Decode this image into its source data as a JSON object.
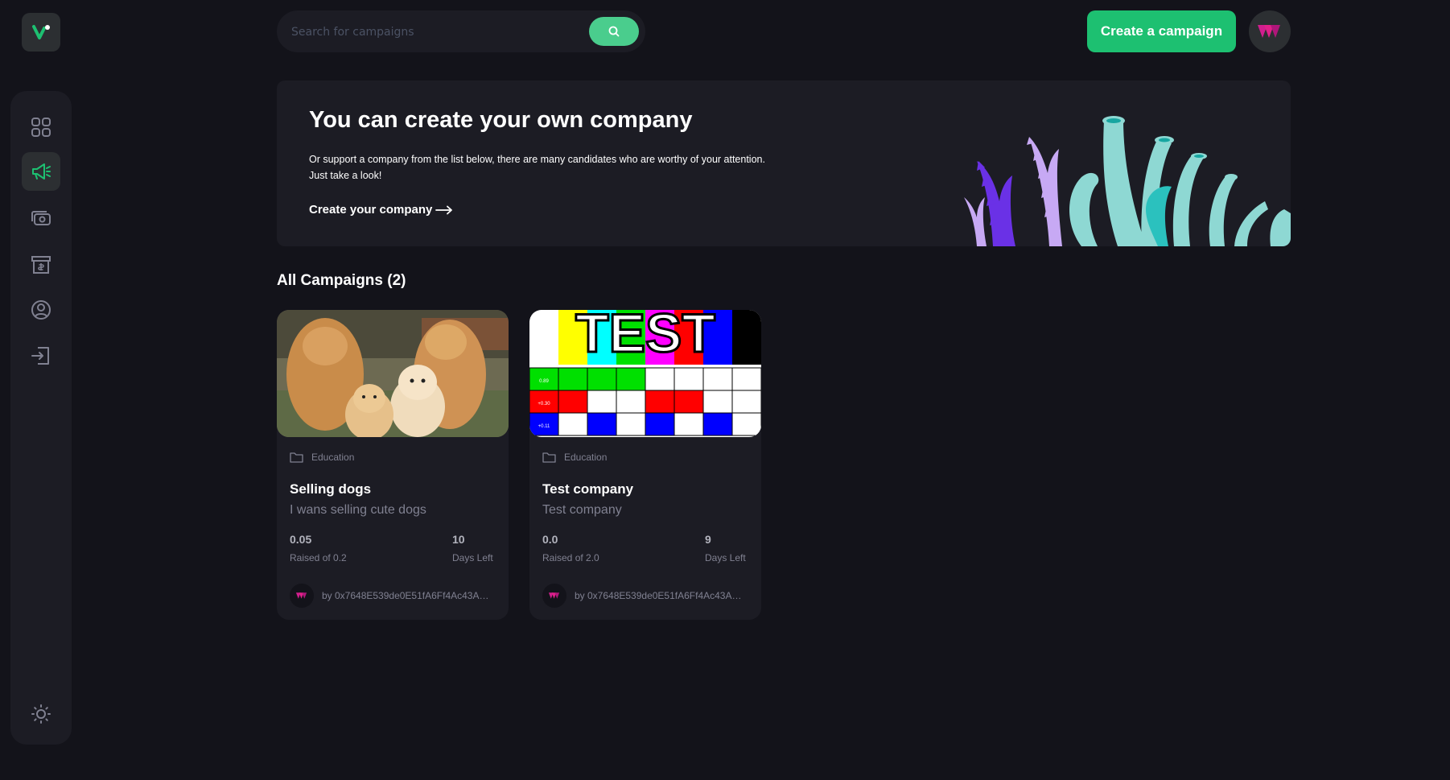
{
  "search": {
    "placeholder": "Search for campaigns"
  },
  "header": {
    "create_label": "Create a campaign"
  },
  "sidebar": {
    "items": [
      {
        "name": "dashboard",
        "icon": "grid-icon",
        "active": false
      },
      {
        "name": "campaign",
        "icon": "megaphone-icon",
        "active": true
      },
      {
        "name": "payment",
        "icon": "money-icon",
        "active": false
      },
      {
        "name": "withdraw",
        "icon": "receipt-icon",
        "active": false
      },
      {
        "name": "profile",
        "icon": "user-circle-icon",
        "active": false
      },
      {
        "name": "logout",
        "icon": "logout-icon",
        "active": false
      }
    ],
    "theme_icon": "sun-icon"
  },
  "banner": {
    "title": "You can create your own company",
    "text_line1": "Or support a company from the list below, there are many candidates who are worthy of your attention.",
    "text_line2": "Just take a look!",
    "link_label": "Create your company"
  },
  "campaigns_section": {
    "title": "All Campaigns (2)"
  },
  "campaigns": [
    {
      "category": "Education",
      "title": "Selling dogs",
      "description": "I wans selling cute dogs",
      "raised": "0.05",
      "raised_label": "Raised of 0.2",
      "days": "10",
      "days_label": "Days Left",
      "owner": "by 0x7648E539de0E51fA6Ff4Ac43A3..."
    },
    {
      "category": "Education",
      "title": "Test company",
      "description": "Test company",
      "raised": "0.0",
      "raised_label": "Raised of 2.0",
      "days": "9",
      "days_label": "Days Left",
      "owner": "by 0x7648E539de0E51fA6Ff4Ac43A3..."
    }
  ],
  "test_image": {
    "heading": "TEST",
    "row_labels": [
      "0.89",
      "+0.30",
      "+0.11"
    ]
  },
  "colors": {
    "background": "#13131a",
    "panel": "#1c1c24",
    "accent_green": "#1dc071",
    "search_green": "#4acd8d",
    "muted_text": "#808191"
  }
}
